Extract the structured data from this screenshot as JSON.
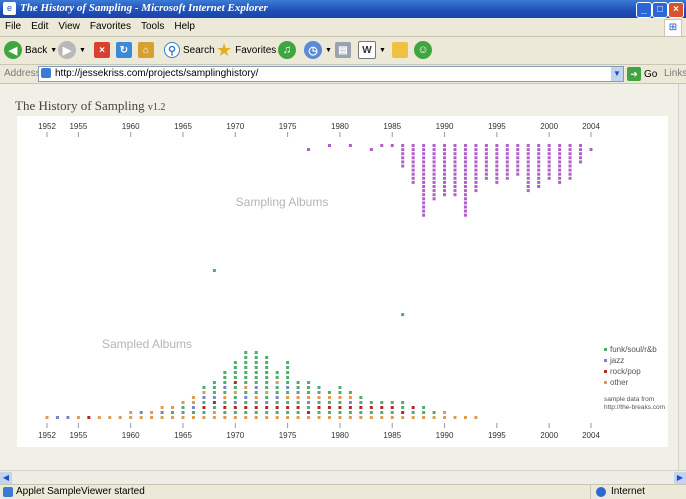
{
  "window": {
    "title": "The History of Sampling - Microsoft Internet Explorer"
  },
  "menu": [
    "File",
    "Edit",
    "View",
    "Favorites",
    "Tools",
    "Help"
  ],
  "toolbar": {
    "back": "Back",
    "search": "Search",
    "favorites": "Favorites"
  },
  "address": {
    "label": "Address",
    "url": "http://jessekriss.com/projects/samplinghistory/",
    "go": "Go",
    "links": "Links"
  },
  "page": {
    "title": "The History of Sampling",
    "version": "v1.2"
  },
  "status": {
    "text": "Applet SampleViewer started",
    "zone": "Internet"
  },
  "colors": {
    "funk": "#4caf6a",
    "jazz": "#7b84c8",
    "rock": "#b32828",
    "other": "#e09a50",
    "sampling": "#b060c8"
  },
  "icons": [
    "ie-page-icon",
    "back-icon",
    "forward-icon",
    "stop-icon",
    "refresh-icon",
    "home-icon",
    "search-icon",
    "favorites-icon",
    "media-icon",
    "history-icon",
    "mail-icon",
    "print-icon",
    "word-icon",
    "folder-icon",
    "messenger-icon",
    "go-icon",
    "internet-zone-icon"
  ],
  "chart_data": {
    "type": "scatter",
    "x_ticks": [
      1952,
      1955,
      1960,
      1965,
      1970,
      1975,
      1980,
      1985,
      1990,
      1995,
      2000,
      2004
    ],
    "xlim": [
      1950,
      2006
    ],
    "top_label": "Sampling Albums",
    "bottom_label": "Sampled Albums",
    "legend": {
      "entries": [
        {
          "key": "funk",
          "label": "funk/soul/r&b"
        },
        {
          "key": "jazz",
          "label": "jazz"
        },
        {
          "key": "rock",
          "label": "rock/pop"
        },
        {
          "key": "other",
          "label": "other"
        }
      ],
      "note1": "sample data from",
      "note2": "http://the-breaks.com",
      "position": "right"
    },
    "sampling_counts": [
      [
        1977,
        1
      ],
      [
        1979,
        1
      ],
      [
        1981,
        1
      ],
      [
        1983,
        1
      ],
      [
        1984,
        1
      ],
      [
        1985,
        1
      ],
      [
        1986,
        6
      ],
      [
        1987,
        10
      ],
      [
        1988,
        18
      ],
      [
        1989,
        14
      ],
      [
        1990,
        13
      ],
      [
        1991,
        13
      ],
      [
        1992,
        18
      ],
      [
        1993,
        12
      ],
      [
        1994,
        9
      ],
      [
        1995,
        10
      ],
      [
        1996,
        9
      ],
      [
        1997,
        8
      ],
      [
        1998,
        12
      ],
      [
        1999,
        11
      ],
      [
        2000,
        9
      ],
      [
        2001,
        10
      ],
      [
        2002,
        9
      ],
      [
        2003,
        5
      ],
      [
        2004,
        1
      ]
    ],
    "sampled_stacks": [
      [
        1952,
        "o"
      ],
      [
        1953,
        "j"
      ],
      [
        1954,
        "j"
      ],
      [
        1955,
        "o"
      ],
      [
        1956,
        "r"
      ],
      [
        1957,
        "o"
      ],
      [
        1958,
        "o"
      ],
      [
        1959,
        "o"
      ],
      [
        1960,
        "oo"
      ],
      [
        1961,
        "oj"
      ],
      [
        1962,
        "oo"
      ],
      [
        1963,
        "ojo"
      ],
      [
        1964,
        "ofo"
      ],
      [
        1965,
        "ojfo"
      ],
      [
        1966,
        "ofjoo"
      ],
      [
        1967,
        "ofrfjof"
      ],
      [
        1968,
        "oofrjfff"
      ],
      [
        1969,
        "ofrfofjfff"
      ],
      [
        1970,
        "ofrjfofrffff"
      ],
      [
        1971,
        "ofrfjfofffffff"
      ],
      [
        1972,
        "ofrfofjfffffff"
      ],
      [
        1973,
        "ofrjfofffffff"
      ],
      [
        1974,
        "ofrfjffoff"
      ],
      [
        1975,
        "ofrfofjfffff"
      ],
      [
        1976,
        "ofrfojff"
      ],
      [
        1977,
        "orfjofff"
      ],
      [
        1978,
        "ofrfojf"
      ],
      [
        1979,
        "ofrfof"
      ],
      [
        1980,
        "ofrfoff"
      ],
      [
        1981,
        "ofrjof"
      ],
      [
        1982,
        "ofrff"
      ],
      [
        1983,
        "ofrf"
      ],
      [
        1984,
        "ofrf"
      ],
      [
        1985,
        "ofrf"
      ],
      [
        1986,
        "orff"
      ],
      [
        1987,
        "ofr"
      ],
      [
        1988,
        "off"
      ],
      [
        1989,
        "of"
      ],
      [
        1990,
        "oo"
      ],
      [
        1991,
        "o"
      ],
      [
        1992,
        "o"
      ],
      [
        1993,
        "o"
      ]
    ],
    "sampled_outliers": [
      [
        1968,
        "f",
        0.7
      ],
      [
        1986,
        "f",
        0.49
      ]
    ]
  }
}
